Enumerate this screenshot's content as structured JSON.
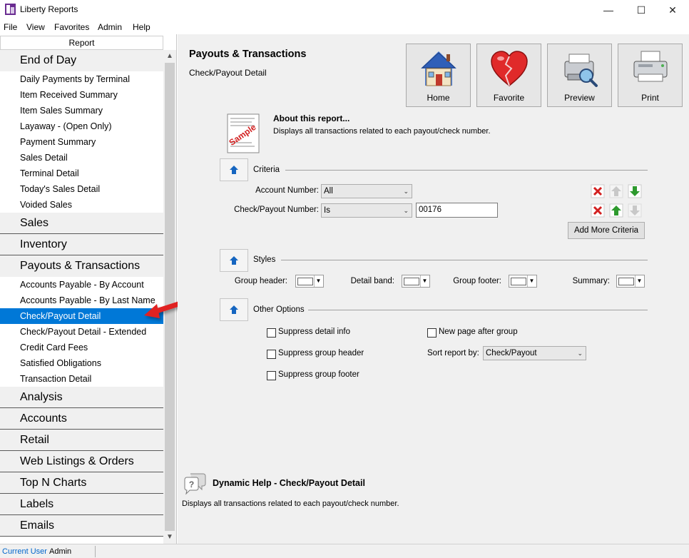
{
  "window": {
    "title": "Liberty Reports",
    "minimize": "—",
    "maximize": "☐",
    "close": "✕"
  },
  "menu": [
    "File",
    "View",
    "Favorites",
    "Admin",
    "Help"
  ],
  "sidebar": {
    "header": "Report",
    "categories": [
      {
        "label": "End of Day",
        "items": [
          "Daily Payments by Terminal",
          "Item Received Summary",
          "Item Sales Summary",
          "Layaway - (Open Only)",
          "Payment Summary",
          "Sales Detail",
          "Terminal Detail",
          "Today's Sales Detail",
          "Voided Sales"
        ]
      },
      {
        "label": "Sales",
        "items": []
      },
      {
        "label": "Inventory",
        "items": []
      },
      {
        "label": "Payouts & Transactions",
        "items": [
          "Accounts Payable - By Account",
          "Accounts Payable - By Last Name",
          "Check/Payout Detail",
          "Check/Payout Detail - Extended",
          "Credit Card Fees",
          "Satisfied Obligations",
          "Transaction Detail"
        ]
      },
      {
        "label": "Analysis",
        "items": []
      },
      {
        "label": "Accounts",
        "items": []
      },
      {
        "label": "Retail",
        "items": []
      },
      {
        "label": "Web Listings & Orders",
        "items": []
      },
      {
        "label": "Top N Charts",
        "items": []
      },
      {
        "label": "Labels",
        "items": []
      },
      {
        "label": "Emails",
        "items": []
      }
    ],
    "selected_item": "Check/Payout Detail"
  },
  "report": {
    "title": "Payouts & Transactions",
    "subtitle": "Check/Payout Detail",
    "about_title": "About this report...",
    "about_desc": "Displays all transactions related to each payout/check number.",
    "sample_text": "Sample"
  },
  "toolbar": {
    "home": "Home",
    "favorite": "Favorite",
    "preview": "Preview",
    "print": "Print"
  },
  "criteria": {
    "section_label": "Criteria",
    "account_label": "Account Number:",
    "account_value": "All",
    "check_label": "Check/Payout Number:",
    "check_operator": "Is",
    "check_value": "00176",
    "add_more": "Add More Criteria"
  },
  "styles": {
    "section_label": "Styles",
    "group_header": "Group header:",
    "detail_band": "Detail band:",
    "group_footer": "Group footer:",
    "summary": "Summary:"
  },
  "options": {
    "section_label": "Other Options",
    "suppress_detail": "Suppress detail info",
    "suppress_group_header": "Suppress group header",
    "suppress_group_footer": "Suppress group footer",
    "new_page": "New page after group",
    "sort_label": "Sort report by:",
    "sort_value": "Check/Payout"
  },
  "help": {
    "title": "Dynamic Help - Check/Payout Detail",
    "desc": "Displays all transactions related to each payout/check number."
  },
  "status": {
    "label": "Current User",
    "user": "Admin"
  }
}
